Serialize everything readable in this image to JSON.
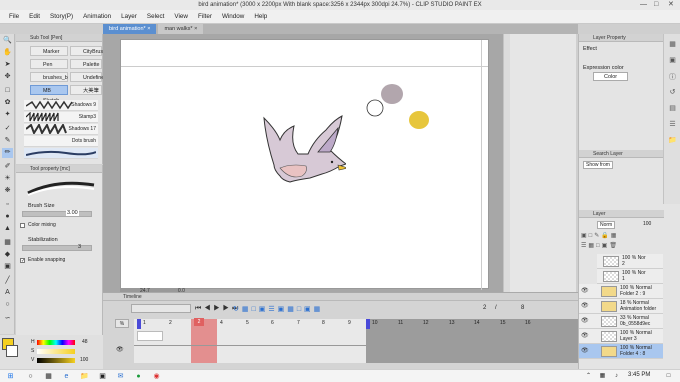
{
  "title_bar": {
    "title": "bird animation* (3000 x 2200px With blank space:3256 x 2344px 300dpi 24.7%) - CLIP STUDIO PAINT EX"
  },
  "menu": [
    "File",
    "Edit",
    "Story(P)",
    "Animation",
    "Layer",
    "Select",
    "View",
    "Filter",
    "Window",
    "Help"
  ],
  "doc_tabs": [
    {
      "label": "bird animation*"
    },
    {
      "label": "man walks*"
    }
  ],
  "sub_tool": {
    "header": "Sub Tool [Pen]",
    "items": [
      "Marker",
      "CityBrush",
      "Pen",
      "Palette Kn",
      "brushes_b",
      "Undefine",
      "MB Skatch",
      "大美筆"
    ],
    "brushes": [
      "Shadows 9",
      "Stamp3",
      "Shadows 17",
      "Dots brush"
    ]
  },
  "tool_property": {
    "header": "Tool property [mc]",
    "brush_size_label": "Brush Size",
    "brush_size_value": "3.00",
    "color_mixing_label": "Color mixing",
    "stabilization_label": "Stabilization",
    "stabilization_value": "3",
    "enable_snapping_label": "Enable snapping"
  },
  "color_panel": {
    "h_label": "H",
    "h_value": "48",
    "s_label": "S",
    "v_label": "V",
    "v_value": "100"
  },
  "layer_property": {
    "header": "Layer Property",
    "effect_label": "Effect",
    "expression_color_label": "Expression color",
    "color_value": "Color"
  },
  "search_layer": {
    "header": "Search Layer",
    "show_from_label": "Show from"
  },
  "layer_panel": {
    "header": "Layer",
    "blend_mode": "Norm",
    "opacity": "100",
    "layers": [
      {
        "name": "100 % Nor",
        "sub": "2"
      },
      {
        "name": "100 % Nor",
        "sub": "1"
      },
      {
        "name": "100 % Normal",
        "sub": "Folder 2 : 9"
      },
      {
        "name": "18 % Normal",
        "sub": "Animation folder"
      },
      {
        "name": "33 % Normal",
        "sub": "0b_0558d9ec"
      },
      {
        "name": "100 % Normal",
        "sub": "Layer 3"
      },
      {
        "name": "100 % Normal",
        "sub": "Folder 4 : 8"
      }
    ]
  },
  "timeline": {
    "header": "Timeline",
    "frame_numbers": [
      "1",
      "2",
      "3",
      "4",
      "5",
      "6",
      "7",
      "8",
      "9",
      "10",
      "11",
      "12",
      "13",
      "14",
      "15",
      "16"
    ],
    "current_frame": "2",
    "playback_current": "2",
    "playback_total": "8",
    "zoom_value": "24.7",
    "angle_value": "0.0"
  },
  "taskbar": {
    "time": "3:45 PM"
  },
  "colors": {
    "accent": "#5b8fd0",
    "playhead": "#e06060",
    "selected_layer": "#a9c7ef"
  }
}
